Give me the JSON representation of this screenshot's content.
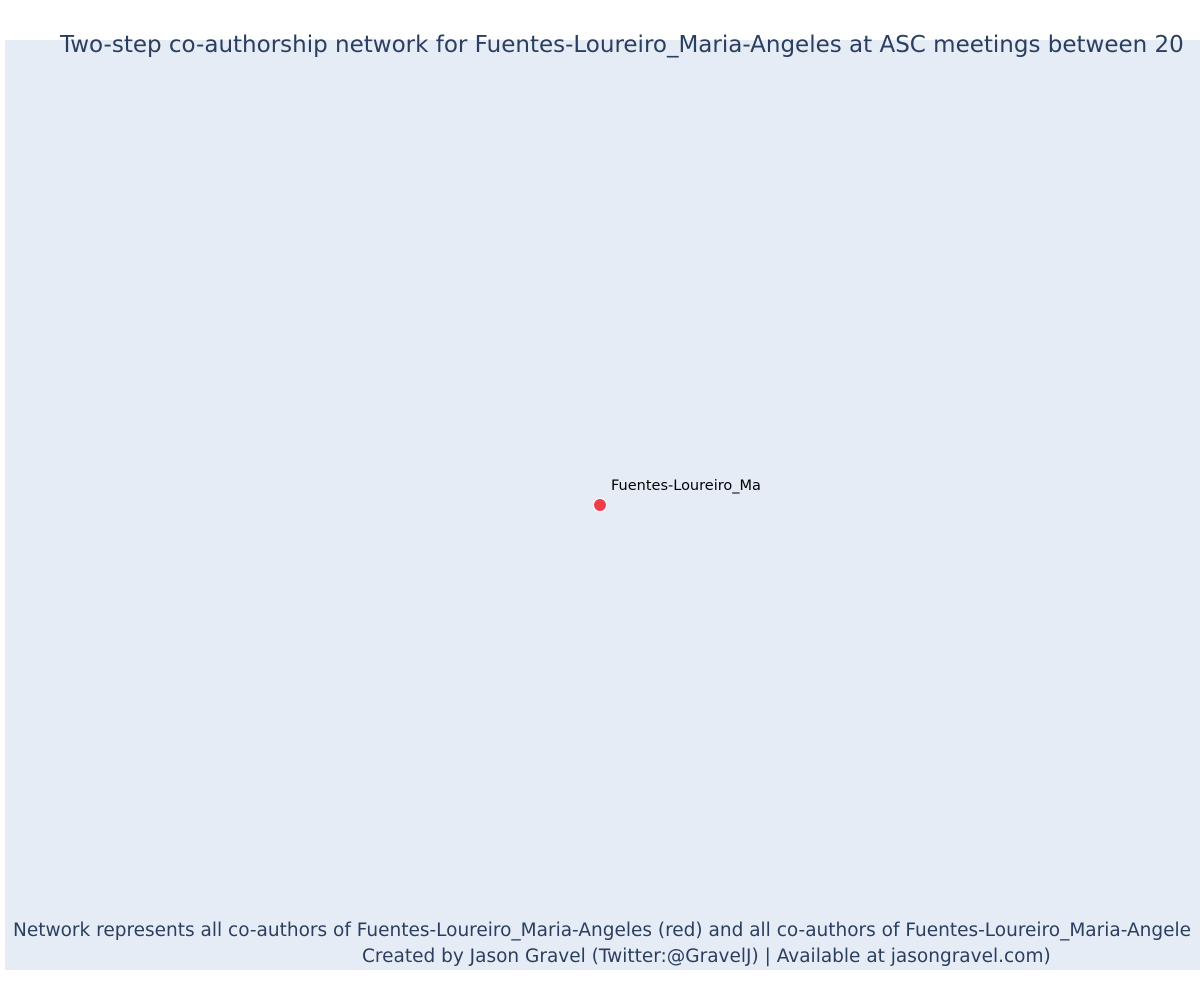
{
  "title": "Two-step co-authorship network for Fuentes-Loureiro_Maria-Angeles at ASC meetings between 20",
  "node": {
    "label": "Fuentes-Loureiro_Ma",
    "color": "#ef3d4a"
  },
  "caption": {
    "line1": "Network represents all co-authors of Fuentes-Loureiro_Maria-Angeles (red) and all co-authors of Fuentes-Loureiro_Maria-Angele",
    "line2": "Created by Jason Gravel (Twitter:@GravelJ) | Available at jasongravel.com)"
  },
  "colors": {
    "plot_background": "#e5ecf6",
    "text": "#2a3f5f"
  }
}
